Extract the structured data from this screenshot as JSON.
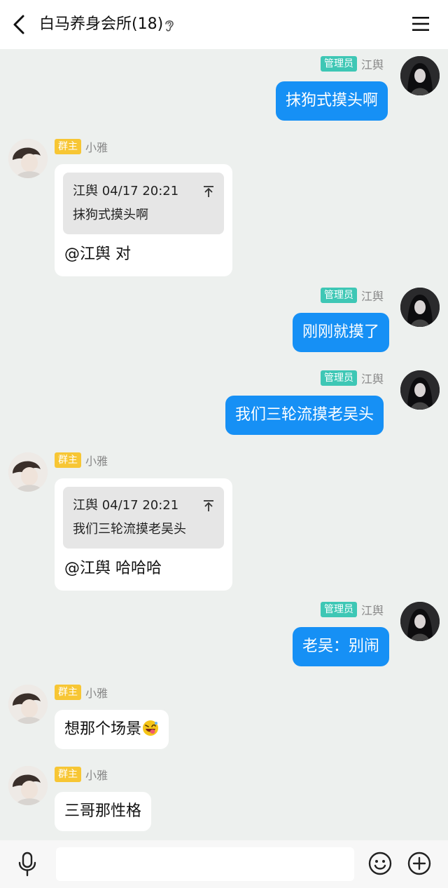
{
  "header": {
    "title": "白马养身会所(18)",
    "back_icon": "chevron-left-icon",
    "ear_icon": "ear-icon",
    "menu_icon": "hamburger-menu-icon"
  },
  "colors": {
    "outgoing_bubble": "#1690f5",
    "admin_badge": "#3ec7b5",
    "owner_badge": "#f7c634",
    "background": "#edf0ee"
  },
  "messages": [
    {
      "direction": "out",
      "badge": "管理员",
      "sender": "江舆",
      "text": "抹狗式摸头啊"
    },
    {
      "direction": "in",
      "badge": "群主",
      "sender": "小雅",
      "quote": {
        "author_time": "江舆 04/17 20:21",
        "text": "抹狗式摸头啊"
      },
      "text": "@江舆 对"
    },
    {
      "direction": "out",
      "badge": "管理员",
      "sender": "江舆",
      "text": "刚刚就摸了"
    },
    {
      "direction": "out",
      "badge": "管理员",
      "sender": "江舆",
      "text": "我们三轮流摸老吴头"
    },
    {
      "direction": "in",
      "badge": "群主",
      "sender": "小雅",
      "quote": {
        "author_time": "江舆 04/17 20:21",
        "text": "我们三轮流摸老吴头"
      },
      "text": "@江舆 哈哈哈"
    },
    {
      "direction": "out",
      "badge": "管理员",
      "sender": "江舆",
      "text": "老吴：别闹"
    },
    {
      "direction": "in",
      "badge": "群主",
      "sender": "小雅",
      "text": "想那个场景",
      "emoji": "grinning-tongue-emoji"
    },
    {
      "direction": "in",
      "badge": "群主",
      "sender": "小雅",
      "text": "三哥那性格"
    }
  ],
  "input_bar": {
    "placeholder": "",
    "value": "",
    "icons": [
      "microphone-icon",
      "smiley-icon",
      "plus-circle-icon"
    ]
  }
}
